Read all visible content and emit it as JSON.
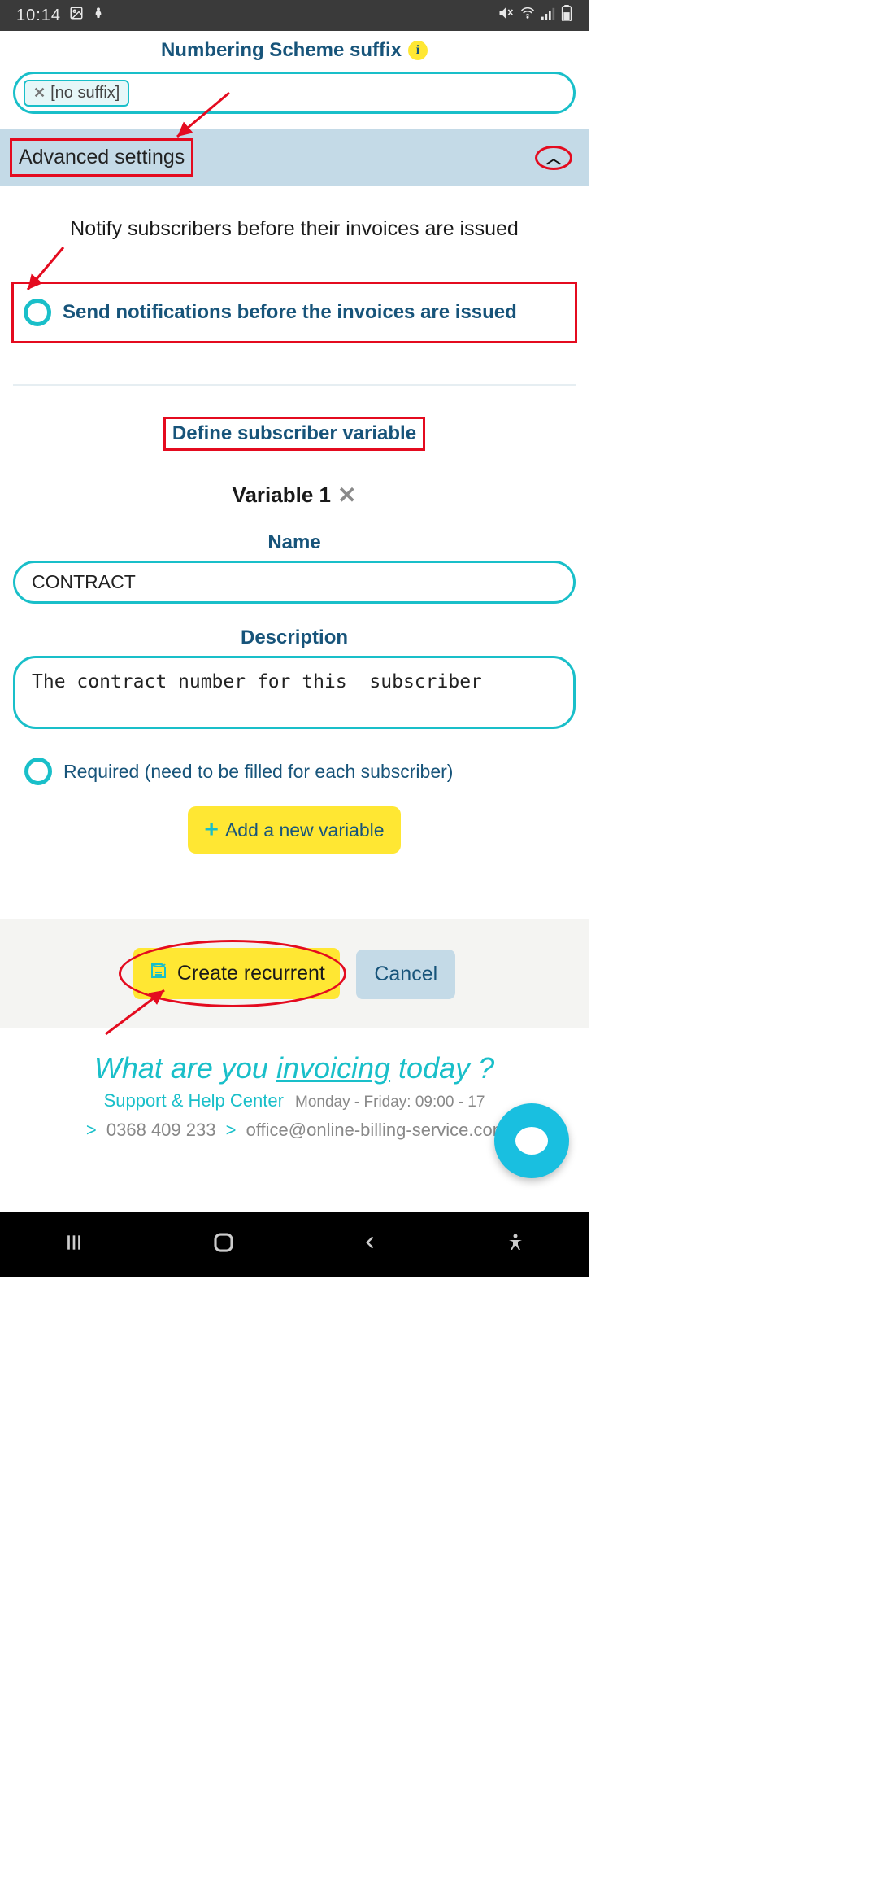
{
  "statusbar": {
    "time": "10:14"
  },
  "numbering": {
    "label": "Numbering Scheme suffix",
    "tag_text": "[no suffix]"
  },
  "accordion": {
    "title": "Advanced settings"
  },
  "notify": {
    "heading": "Notify subscribers before their invoices are issued",
    "checkbox_label": "Send notifications before the invoices are issued"
  },
  "variable": {
    "heading": "Define subscriber variable",
    "var_label": "Variable 1",
    "name_label": "Name",
    "name_value": "CONTRACT",
    "desc_label": "Description",
    "desc_value": "The contract number for this  subscriber",
    "required_label": "Required (need to be filled for each subscriber)",
    "add_label": "Add a new variable"
  },
  "buttons": {
    "create": "Create recurrent",
    "cancel": "Cancel"
  },
  "footer": {
    "tagline_pre": "What are you ",
    "tagline_inv": "invoicing",
    "tagline_post": " today ?",
    "support_label": "Support & Help Center",
    "support_hours": "Monday - Friday: 09:00 - 17",
    "phone": "0368 409 233",
    "email": "office@online-billing-service.com"
  }
}
